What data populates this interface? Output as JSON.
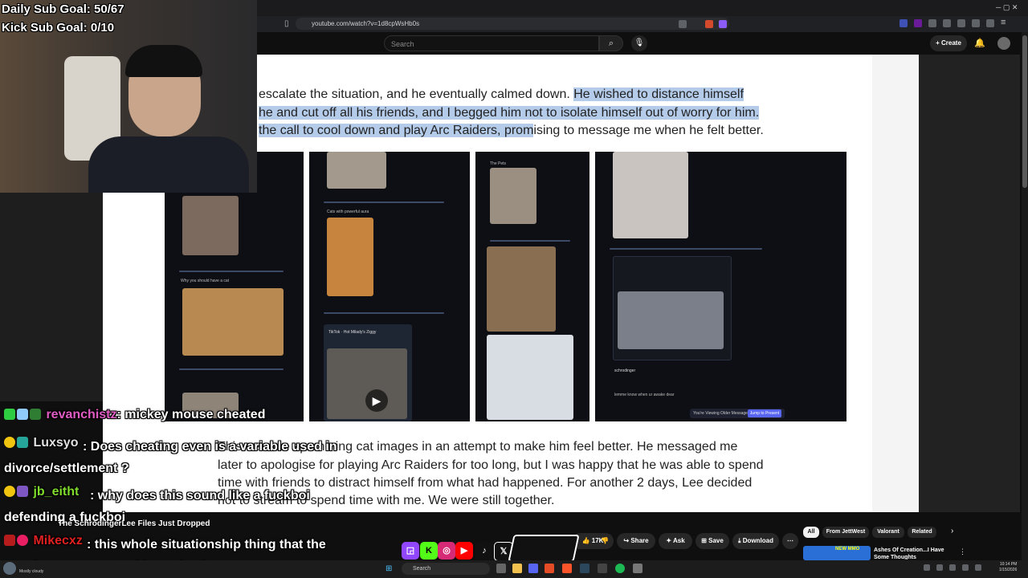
{
  "stream": {
    "daily_goal": "Daily Sub Goal: 50/67",
    "kick_goal": "Kick Sub Goal: 0/10"
  },
  "browser": {
    "url": "youtube.com/watch?v=1d8cpWsHb0s"
  },
  "youtube": {
    "search_placeholder": "Search",
    "create_label": "Create",
    "likes": "17K",
    "share": "Share",
    "ask": "Ask",
    "save": "Save",
    "download": "Download",
    "filters": [
      "All",
      "From JettWest",
      "Valorant",
      "Related"
    ],
    "rec_title": "Ashes Of Creation...I Have Some Thoughts",
    "rec_thumb_text": "NEW MMO"
  },
  "document": {
    "line1_plain": "escalate the situation, and he eventually calmed down. ",
    "line1_hl": "He wished to distance himself",
    "line2_hl": "he and cut off all his friends, and I begged him not to isolate himself out of worry for him.",
    "line3_hl": " the call to cool down and play Arc Raiders, prom",
    "line3_plain": "ising to message me when he felt better.",
    "para2_line1": "This was me spamming cat images in an attempt to make him feel better. He messaged me",
    "para2_line2": "later to apologise for playing Arc Raiders for too long, but I was happy that he was able to spend",
    "para2_line3": "time with friends to distract himself from what had happened. For another 2 days, Lee decided",
    "para2_line4": "not to stream to spend time with me. We were still together."
  },
  "screenshots": {
    "shot1_heading": "Why you should have a cat",
    "shot2_caption": "Cats with powerful aura",
    "shot2_tiktok": "TikTok · Hot Milady's Ziggy",
    "shot3_user": "The Pets",
    "shot4_user": "schrodinger",
    "shot4_msg": "lemme know when ur awake dear",
    "shot4_viewing": "You're Viewing Older Messages",
    "shot4_jump": "Jump to Present"
  },
  "chat": [
    {
      "user": "revanchistz",
      "color": "#e05cc4",
      "message": ": mickey mouse cheated"
    },
    {
      "user": "Luxsyo",
      "color": "#e0e0e0",
      "message": ": Does cheating even is a variable used in divorce/settlement ?"
    },
    {
      "user": "jb_eitht",
      "color": "#7fdc2c",
      "message": ": why does this sound like a fuckboi defending a fuckboi"
    },
    {
      "user": "Mikecxz",
      "color": "#e02020",
      "message": ": this whole situationship thing that the genz/zoomers created is so dumb"
    }
  ],
  "video_meta": {
    "channel_line": "The SchrodingerLee Files Just Dropped"
  },
  "taskbar": {
    "weather": "Mostly cloudy",
    "search": "Search",
    "time": "10:14 PM",
    "date": "1/15/2026"
  },
  "colors": {
    "highlight": "#b4cbe9",
    "youtube_bg": "#0f0f0f",
    "chat_user_1": "#e05cc4",
    "chat_user_3": "#7fdc2c",
    "chat_user_4": "#e02020"
  }
}
